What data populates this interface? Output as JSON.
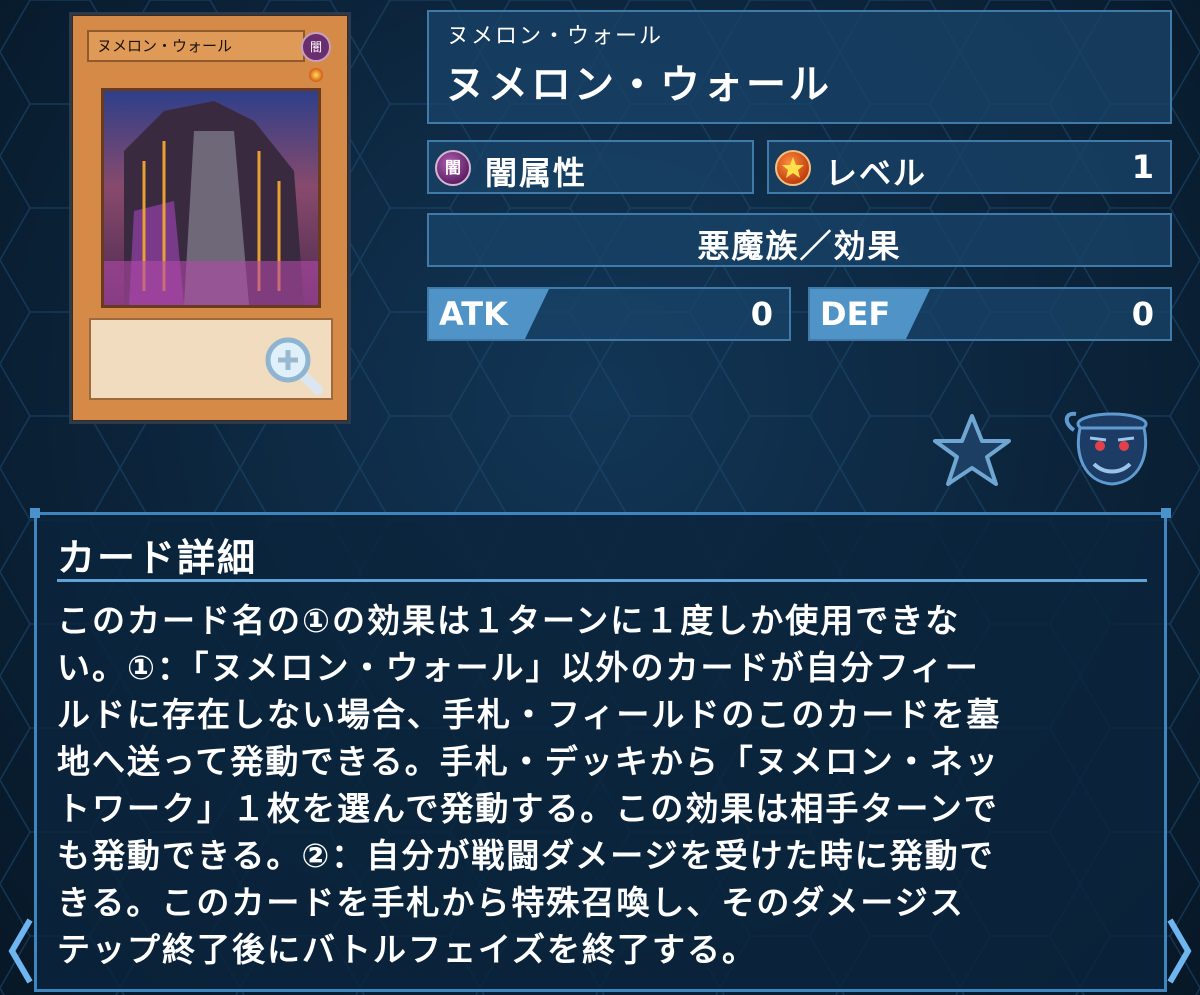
{
  "card": {
    "small_name": "ヌメロン・ウォール",
    "attribute_glyph": "闇"
  },
  "header": {
    "sub_name": "ヌメロン・ウォール",
    "name": "ヌメロン・ウォール"
  },
  "attribute": {
    "icon": "dark-attribute-icon",
    "label": "闇属性"
  },
  "level": {
    "icon": "level-star-icon",
    "label": "レベル",
    "value": "1"
  },
  "type_line": "悪魔族／効果",
  "atk": {
    "label": "ATK",
    "value": "0"
  },
  "def": {
    "label": "DEF",
    "value": "0"
  },
  "actions": {
    "favorite_icon": "star-icon",
    "pot_icon": "pot-of-greed-icon"
  },
  "details": {
    "title": "カード詳細",
    "text": "このカード名の①の効果は１ターンに１度しか使用できな\nい。①：「ヌメロン・ウォール」以外のカードが自分フィー\nルドに存在しない場合、手札・フィールドのこのカードを墓\n地へ送って発動できる。手札・デッキから「ヌメロン・ネッ\nトワーク」１枚を選んで発動する。この効果は相手ターンで\nも発動できる。②：自分が戦闘ダメージを受けた時に発動で\nきる。このカードを手札から特殊召喚し、そのダメージス\nテップ終了後にバトルフェイズを終了する。"
  },
  "colors": {
    "accent": "#4f93c7",
    "panel": "#184268",
    "border": "#3f7aa8"
  }
}
